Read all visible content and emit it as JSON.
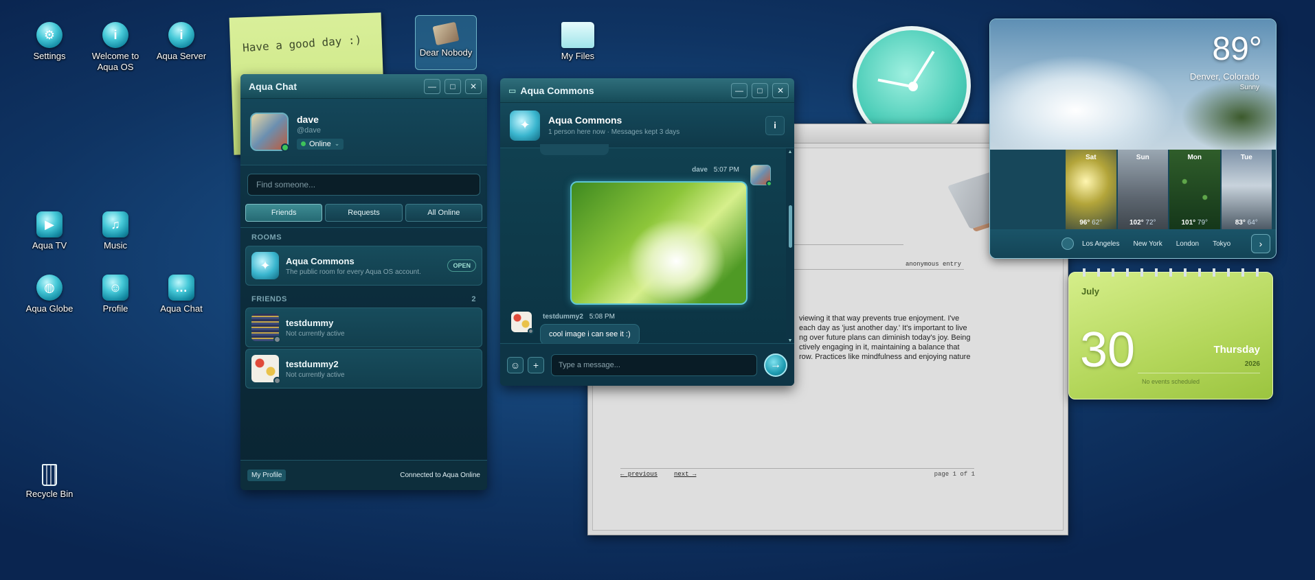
{
  "desktop": {
    "icons": [
      {
        "label": "Settings"
      },
      {
        "label": "Welcome to Aqua OS"
      },
      {
        "label": "Aqua Server"
      },
      {
        "label": "Dear Nobody"
      },
      {
        "label": "My Files"
      },
      {
        "label": "Aqua TV"
      },
      {
        "label": "Music"
      },
      {
        "label": "Aqua Globe"
      },
      {
        "label": "Profile"
      },
      {
        "label": "Aqua Chat"
      },
      {
        "label": "Recycle Bin"
      }
    ],
    "sticky_note": "Have a good day :)"
  },
  "aqua_chat": {
    "title": "Aqua Chat",
    "user": {
      "name": "dave",
      "handle": "@dave",
      "status": "Online"
    },
    "search_placeholder": "Find someone...",
    "tabs": [
      "Friends",
      "Requests",
      "All Online"
    ],
    "rooms_header": "ROOMS",
    "room": {
      "name": "Aqua Commons",
      "desc": "The public room for every Aqua OS account.",
      "badge": "OPEN"
    },
    "friends_header": "FRIENDS",
    "friends_count": "2",
    "friends": [
      {
        "name": "testdummy",
        "status": "Not currently active"
      },
      {
        "name": "testdummy2",
        "status": "Not currently active"
      }
    ],
    "footer": {
      "profile": "My Profile",
      "connection": "Connected to Aqua Online"
    }
  },
  "commons": {
    "title": "Aqua Commons",
    "room_name": "Aqua Commons",
    "room_info": "1 person here now · Messages kept 3 days",
    "messages": [
      {
        "author": "dave",
        "time": "5:07 PM"
      },
      {
        "author": "testdummy2",
        "time": "5:08 PM",
        "text": "cool image i can see it :)"
      }
    ],
    "input_placeholder": "Type a message..."
  },
  "document": {
    "byline": "anonymous entry",
    "body": [
      "viewing it that way prevents true enjoyment. I've",
      "each day as 'just another day.' It's important to live",
      "ng over future plans can diminish today's joy. Being",
      "ctively engaging in it, maintaining a balance that",
      "row. Practices like mindfulness and enjoying nature"
    ],
    "prev": "← previous",
    "next": "next →",
    "page": "page 1 of 1"
  },
  "weather": {
    "temp": "89°",
    "city": "Denver, Colorado",
    "condition": "Sunny",
    "forecast": [
      {
        "day": "Sat",
        "hi": "96°",
        "lo": "62°"
      },
      {
        "day": "Sun",
        "hi": "102°",
        "lo": "72°"
      },
      {
        "day": "Mon",
        "hi": "101°",
        "lo": "79°"
      },
      {
        "day": "Tue",
        "hi": "83°",
        "lo": "64°"
      }
    ],
    "cities": [
      "Los Angeles",
      "New York",
      "London",
      "Tokyo"
    ]
  },
  "calendar": {
    "month": "July",
    "day": "30",
    "weekday": "Thursday",
    "year": "2026",
    "events": "No events scheduled"
  }
}
